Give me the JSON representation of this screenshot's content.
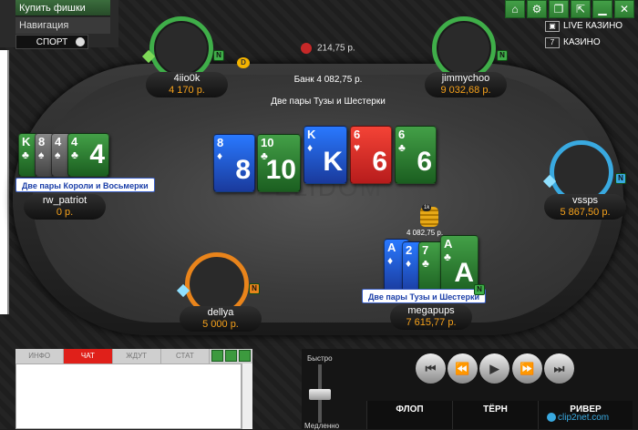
{
  "left_menu": {
    "buy_chips": "Купить фишки",
    "navigation": "Навигация",
    "sport": "СПОРТ"
  },
  "top_right": {
    "live_casino": "LIVE КАЗИНО",
    "casino": "КАЗИНО"
  },
  "table": {
    "watermark": "PELIDOM",
    "pot": "Банк 4 082,75 р.",
    "best_hand": "Две пары Тузы и Шестерки",
    "rake": "214,75 р.",
    "dealer_button": "D",
    "bet": {
      "chip_label": "1k",
      "amount": "4 082,75 р."
    }
  },
  "board": [
    {
      "rank": "8",
      "suit": "♦",
      "color": "blue"
    },
    {
      "rank": "10",
      "suit": "♣",
      "color": "green"
    },
    {
      "rank": "K",
      "suit": "♦",
      "color": "blue"
    },
    {
      "rank": "6",
      "suit": "♥",
      "color": "red"
    },
    {
      "rank": "6",
      "suit": "♣",
      "color": "green"
    }
  ],
  "players": {
    "top_left": {
      "name": "4iio0k",
      "stack": "4 170 р.",
      "badge": "N"
    },
    "top_right": {
      "name": "jimmychoo",
      "stack": "9 032,68 р.",
      "badge": "N"
    },
    "right": {
      "name": "vssps",
      "stack": "5 867,50 р.",
      "badge": "N"
    },
    "bottom_left": {
      "name": "dellya",
      "stack": "5 000 р.",
      "badge": "N"
    },
    "bottom_right": {
      "name": "megapups",
      "stack": "7 615,77 р.",
      "badge": "N",
      "hand_label": "Две пары Тузы и Шестерки",
      "cards": [
        {
          "rank": "A",
          "suit": "♦",
          "color": "blue"
        },
        {
          "rank": "2",
          "suit": "♦",
          "color": "blue"
        },
        {
          "rank": "7",
          "suit": "♣",
          "color": "green"
        },
        {
          "rank": "A",
          "suit": "♣",
          "color": "green"
        }
      ]
    },
    "left": {
      "name": "rw_patriot",
      "stack": "0 р.",
      "hand_label": "Две пары Короли и Восьмерки",
      "cards": [
        {
          "rank": "K",
          "suit": "♣",
          "color": "green"
        },
        {
          "rank": "8",
          "suit": "♠",
          "color": "gray"
        },
        {
          "rank": "4",
          "suit": "♠",
          "color": "gray"
        },
        {
          "rank": "4",
          "suit": "♣",
          "color": "green"
        }
      ]
    }
  },
  "chat": {
    "tabs": [
      "ИНФО",
      "ЧАТ",
      "ЖДУТ",
      "СТАТ"
    ],
    "active_tab": "ЧАТ"
  },
  "replay": {
    "speed_fast": "Быстро",
    "speed_slow": "Медленно",
    "controls": [
      "⏮",
      "⏪",
      "▶",
      "⏩",
      "⏭"
    ],
    "streets": [
      "ФЛОП",
      "ТЁРН",
      "РИВЕР"
    ]
  },
  "watermark_app": "clip2net.com"
}
